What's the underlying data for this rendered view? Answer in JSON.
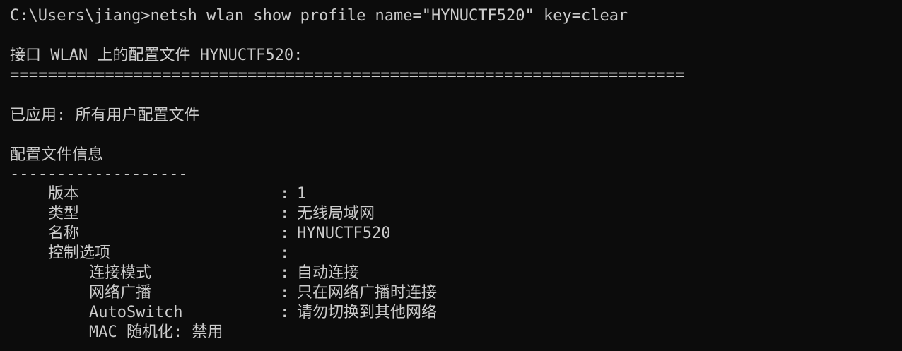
{
  "terminal": {
    "command_line": "C:\\Users\\jiang>netsh wlan show profile name=\"HYNUCTF520\" key=clear",
    "interface_header": "接口 WLAN 上的配置文件 HYNUCTF520:",
    "separator_equals": "=======================================================================",
    "applied": "已应用: 所有用户配置文件",
    "section_title": "配置文件信息",
    "separator_dashes": "-------------------",
    "rows": [
      {
        "key": "版本",
        "colon": ":",
        "value": "1"
      },
      {
        "key": "类型",
        "colon": ":",
        "value": "无线局域网"
      },
      {
        "key": "名称",
        "colon": ":",
        "value": "HYNUCTF520"
      },
      {
        "key": "控制选项",
        "colon": ":",
        "value": ""
      }
    ],
    "subrows": [
      {
        "key": "连接模式",
        "colon": ":",
        "value": "自动连接"
      },
      {
        "key": "网络广播",
        "colon": ":",
        "value": "只在网络广播时连接"
      },
      {
        "key": "AutoSwitch",
        "colon": ":",
        "value": "请勿切换到其他网络"
      },
      {
        "key": "MAC 随机化: 禁用",
        "colon": "",
        "value": ""
      }
    ]
  }
}
